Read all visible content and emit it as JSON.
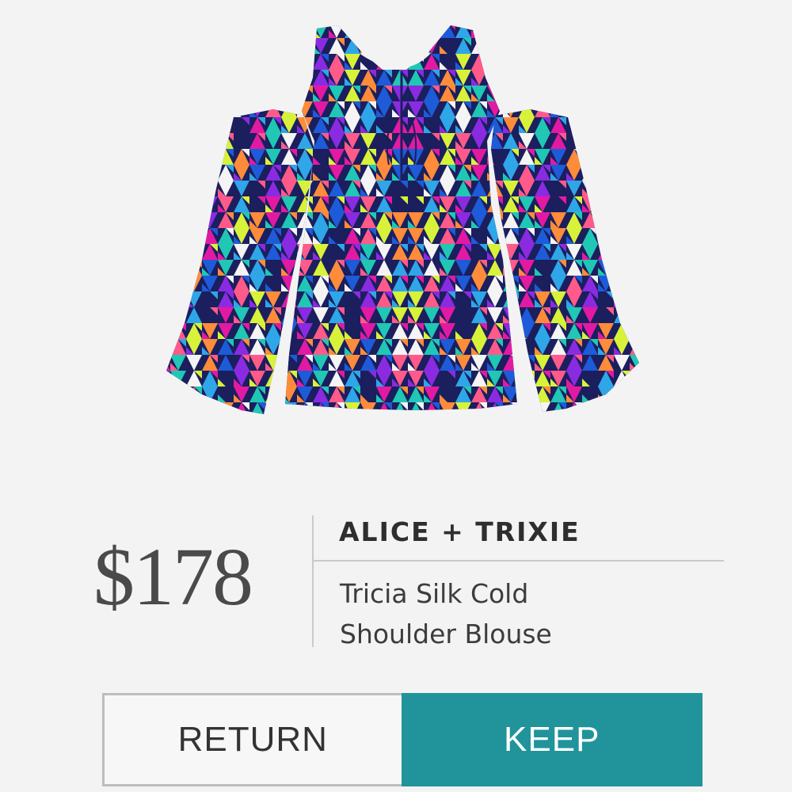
{
  "product": {
    "image_icon": "patterned-blouse-image",
    "price": "$178",
    "brand": "ALICE + TRIXIE",
    "name": "Tricia Silk Cold Shoulder Blouse"
  },
  "actions": {
    "return_label": "RETURN",
    "keep_label": "KEEP"
  },
  "colors": {
    "background": "#f3f3f3",
    "keep_button": "#20949a",
    "return_border": "#bdbdbd",
    "price_text": "#4a4a4a",
    "pattern_palette": [
      "#1b1f5e",
      "#1e5bd8",
      "#e21aa3",
      "#8a2be2",
      "#20c7b5",
      "#ff5a8a",
      "#f4f4f4",
      "#d8f23a",
      "#2fa6e8",
      "#ff8c3a"
    ]
  }
}
